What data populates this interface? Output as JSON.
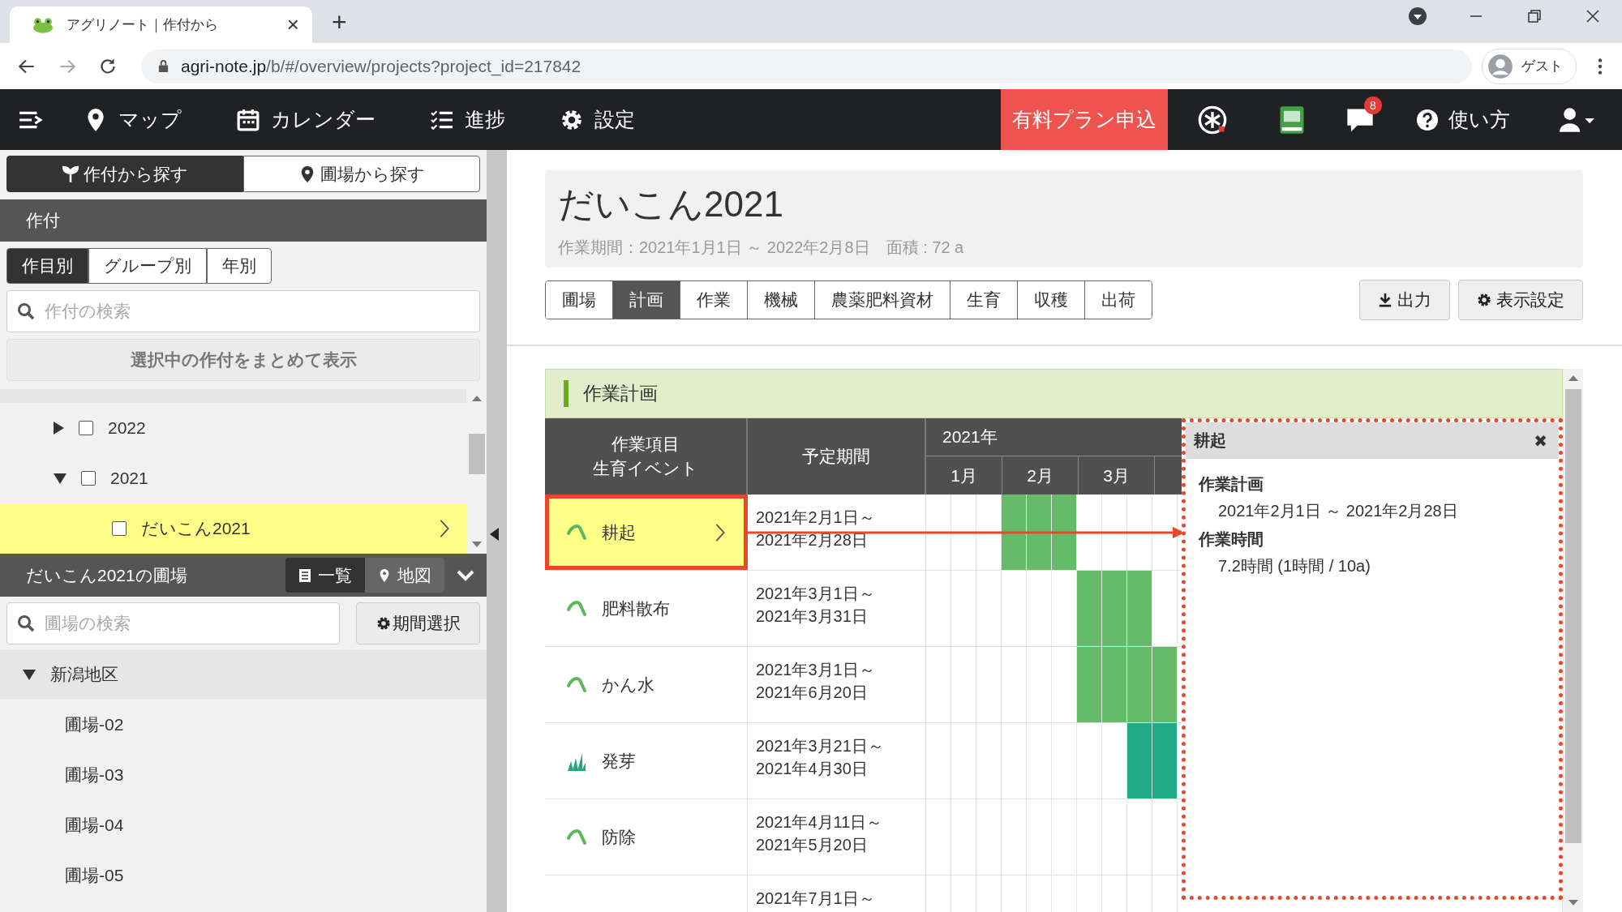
{
  "browser": {
    "tab_title": "アグリノート｜作付から",
    "close_tab": "×",
    "new_tab": "+",
    "url_host": "agri-note.jp",
    "url_path": "/b/#/overview/projects?project_id=217842",
    "profile": "ゲスト"
  },
  "nav": {
    "items": [
      {
        "label": "マップ",
        "kind": "pin"
      },
      {
        "label": "カレンダー",
        "kind": "calendar"
      },
      {
        "label": "進捗",
        "kind": "list"
      },
      {
        "label": "設定",
        "kind": "gear"
      }
    ],
    "plan_button": "有料プラン申込",
    "notification_count": "8",
    "help": "使い方"
  },
  "sidebar": {
    "search_modes": [
      {
        "label": "作付から探す",
        "selected": true
      },
      {
        "label": "圃場から探す",
        "selected": false
      }
    ],
    "section_title": "作付",
    "group_tabs": [
      {
        "label": "作目別",
        "selected": true
      },
      {
        "label": "グループ別",
        "selected": false
      },
      {
        "label": "年別",
        "selected": false
      }
    ],
    "crop_search": {
      "placeholder": "作付の検索"
    },
    "show_selected_button": "選択中の作付をまとめて表示",
    "tree": [
      {
        "label": "2022",
        "expanded": false,
        "checked": false
      },
      {
        "label": "2021",
        "expanded": true,
        "checked": false,
        "children": [
          {
            "label": "だいこん2021",
            "checked": false,
            "selected": true
          }
        ]
      }
    ],
    "fields_title": "だいこん2021の圃場",
    "view_toggle": [
      {
        "label": "一覧",
        "selected": true
      },
      {
        "label": "地図",
        "selected": false
      }
    ],
    "field_search": {
      "placeholder": "圃場の検索"
    },
    "period_button": "期間選択",
    "field_groups": [
      {
        "label": "新潟地区",
        "expanded": true,
        "children": [
          {
            "label": "圃場-02"
          },
          {
            "label": "圃場-03"
          },
          {
            "label": "圃場-04"
          },
          {
            "label": "圃場-05"
          }
        ]
      }
    ]
  },
  "project": {
    "title": "だいこん2021",
    "summary": "作業期間：2021年1月1日 ～ 2022年2月8日　面積 : 72 a",
    "tabs": [
      {
        "label": "圃場",
        "selected": false
      },
      {
        "label": "計画",
        "selected": true
      },
      {
        "label": "作業",
        "selected": false
      },
      {
        "label": "機械",
        "selected": false
      },
      {
        "label": "農薬肥料資材",
        "selected": false
      },
      {
        "label": "生育",
        "selected": false
      },
      {
        "label": "収穫",
        "selected": false
      },
      {
        "label": "出荷",
        "selected": false
      }
    ],
    "export_button": "出力",
    "display_settings_button": "表示設定"
  },
  "plan": {
    "title": "作業計画",
    "item_header": [
      "作業項目",
      "生育イベント"
    ],
    "period_header": "予定期間",
    "year": "2021年",
    "months": [
      "1月",
      "2月",
      "3月"
    ],
    "rows": [
      {
        "kind": "work",
        "name": "耕起",
        "start": "2021年2月1日～",
        "end": "2021年2月28日",
        "selected": true,
        "color": "#66bb6a",
        "filled": [
          false,
          false,
          false,
          true,
          true,
          true,
          false,
          false,
          false,
          false
        ]
      },
      {
        "kind": "work",
        "name": "肥料散布",
        "start": "2021年3月1日～",
        "end": "2021年3月31日",
        "selected": false,
        "color": "#66bb6a",
        "filled": [
          false,
          false,
          false,
          false,
          false,
          false,
          true,
          true,
          true,
          false
        ]
      },
      {
        "kind": "work",
        "name": "かん水",
        "start": "2021年3月1日～",
        "end": "2021年6月20日",
        "selected": false,
        "color": "#66bb6a",
        "filled": [
          false,
          false,
          false,
          false,
          false,
          false,
          true,
          true,
          true,
          true
        ]
      },
      {
        "kind": "growth",
        "name": "発芽",
        "start": "2021年3月21日～",
        "end": "2021年4月30日",
        "selected": false,
        "color": "#22aa88",
        "filled": [
          false,
          false,
          false,
          false,
          false,
          false,
          false,
          false,
          true,
          true
        ]
      },
      {
        "kind": "work",
        "name": "防除",
        "start": "2021年4月11日～",
        "end": "2021年5月20日",
        "selected": false,
        "filled": [
          false,
          false,
          false,
          false,
          false,
          false,
          false,
          false,
          false,
          false
        ]
      },
      {
        "start": "2021年7月1日～",
        "selected": false,
        "filled": [
          false,
          false,
          false,
          false,
          false,
          false,
          false,
          false,
          false,
          false
        ]
      }
    ]
  },
  "detail": {
    "title": "耕起",
    "close": "✖",
    "sections": [
      {
        "heading": "作業計画",
        "value": "2021年2月1日 ～ 2021年2月28日"
      },
      {
        "heading": "作業時間",
        "value": "7.2時間 (1時間 / 10a)"
      }
    ]
  }
}
